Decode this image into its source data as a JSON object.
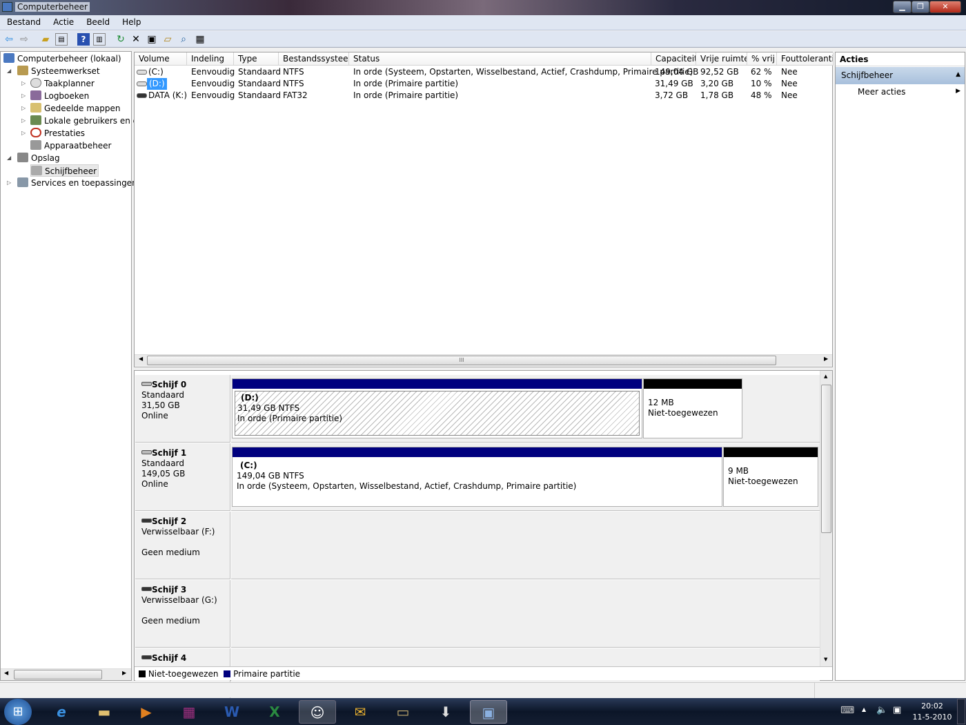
{
  "window": {
    "title": "Computerbeheer",
    "controls": [
      "minimize",
      "restore",
      "close"
    ]
  },
  "menu": [
    "Bestand",
    "Actie",
    "Beeld",
    "Help"
  ],
  "toolbar": [
    "back-icon",
    "forward-icon",
    "up-folder-icon",
    "show-hide-tree-icon",
    "help-icon",
    "show-hide-action-pane-icon",
    "refresh-icon",
    "delete-icon",
    "properties-icon",
    "open-icon",
    "explore-icon",
    "disk-settings-icon"
  ],
  "tree": {
    "root": "Computerbeheer (lokaal)",
    "system_tools": "Systeemwerkset",
    "task_scheduler": "Taakplanner",
    "event_viewer": "Logboeken",
    "shared_folders": "Gedeelde mappen",
    "local_users": "Lokale gebruikers en groepen",
    "performance": "Prestaties",
    "device_manager": "Apparaatbeheer",
    "storage": "Opslag",
    "disk_management": "Schijfbeheer",
    "services": "Services en toepassingen"
  },
  "volumes": {
    "columns": [
      "Volume",
      "Indeling",
      "Type",
      "Bestandssysteem",
      "Status",
      "Capaciteit",
      "Vrije ruimte",
      "% vrij",
      "Fouttolerantie"
    ],
    "rows": [
      [
        "(C:)",
        "Eenvoudig",
        "Standaard",
        "NTFS",
        "In orde (Systeem, Opstarten, Wisselbestand, Actief, Crashdump, Primaire partitie)",
        "149,04 GB",
        "92,52 GB",
        "62 %",
        "Nee"
      ],
      [
        "(D:)",
        "Eenvoudig",
        "Standaard",
        "NTFS",
        "In orde (Primaire partitie)",
        "31,49 GB",
        "3,20 GB",
        "10 %",
        "Nee"
      ],
      [
        "DATA (K:)",
        "Eenvoudig",
        "Standaard",
        "FAT32",
        "In orde (Primaire partitie)",
        "3,72 GB",
        "1,78 GB",
        "48 %",
        "Nee"
      ]
    ],
    "selected_row": 1
  },
  "disks": [
    {
      "name": "Schijf 0",
      "type": "Standaard",
      "size": "31,50 GB",
      "state": "Online",
      "partitions": [
        {
          "label": "(D:)",
          "size": "31,49 GB NTFS",
          "status": "In orde (Primaire partitie)"
        }
      ],
      "unallocated": {
        "size": "12 MB",
        "label": "Niet-toegewezen"
      }
    },
    {
      "name": "Schijf 1",
      "type": "Standaard",
      "size": "149,05 GB",
      "state": "Online",
      "partitions": [
        {
          "label": "(C:)",
          "size": "149,04 GB NTFS",
          "status": "In orde (Systeem, Opstarten, Wisselbestand, Actief, Crashdump, Primaire partitie)"
        }
      ],
      "unallocated": {
        "size": "9 MB",
        "label": "Niet-toegewezen"
      }
    },
    {
      "name": "Schijf 2",
      "type": "Verwisselbaar (F:)",
      "state": "Geen medium"
    },
    {
      "name": "Schijf 3",
      "type": "Verwisselbaar (G:)",
      "state": "Geen medium"
    },
    {
      "name": "Schijf 4"
    }
  ],
  "legend": [
    {
      "label": "Niet-toegewezen",
      "color": "#000000"
    },
    {
      "label": "Primaire partitie",
      "color": "#00007f"
    }
  ],
  "actions": {
    "title": "Acties",
    "section": "Schijfbeheer",
    "more": "Meer acties"
  },
  "clock": {
    "time": "20:02",
    "date": "11-5-2010"
  },
  "taskbar": [
    "start",
    "internet-explorer",
    "windows-explorer",
    "media-player",
    "winrar",
    "word",
    "excel",
    "network-app",
    "outlook-express",
    "folder-app",
    "download-app",
    "computer-management"
  ]
}
